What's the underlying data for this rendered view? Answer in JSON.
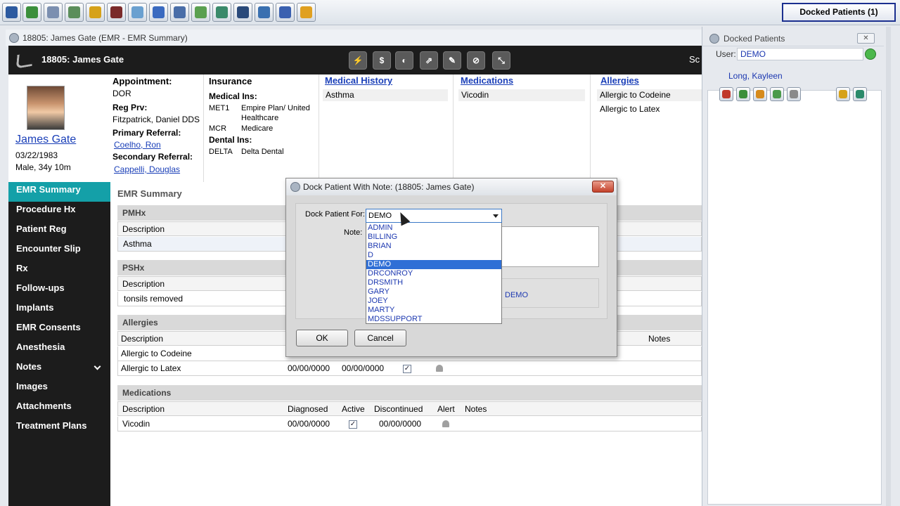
{
  "toolbar": {
    "icons": [
      "patient-icon",
      "new-icon",
      "search-icon",
      "scheduler-icon",
      "ledger-icon",
      "tooth-icon",
      "claims-icon",
      "transfer-icon",
      "reports-icon",
      "map-icon",
      "chat-icon",
      "window-icon",
      "document-icon",
      "download-icon",
      "exit-icon"
    ],
    "icon_colors": [
      "#2c5aa0",
      "#3b8f3b",
      "#7b8fb0",
      "#5b8e5b",
      "#d6a21a",
      "#7a2a2a",
      "#6aa0d0",
      "#3a6ac0",
      "#4a6ea8",
      "#5aa050",
      "#3a8a6a",
      "#2a4a7a",
      "#3a70b0",
      "#3a60b0",
      "#e0a020"
    ],
    "docked_button": "Docked Patients (1)"
  },
  "window": {
    "title": "18805: James Gate (EMR - EMR Summary)"
  },
  "header": {
    "title": "18805: James Gate",
    "right_text": "Sc",
    "buttons": [
      "⚡",
      "$",
      "◐",
      "⇗",
      "✎",
      "⊘",
      "⤡"
    ]
  },
  "patient": {
    "name": "James Gate",
    "dob": "03/22/1983",
    "sex_age": "Male, 34y 10m",
    "appointment_label": "Appointment:",
    "appointment_value": "DOR",
    "reg_prv_label": "Reg Prv:",
    "reg_prv_value": "Fitzpatrick, Daniel DDS",
    "primary_ref_label": "Primary Referral:",
    "primary_ref_value": "Coelho, Ron",
    "secondary_ref_label": "Secondary Referral:",
    "secondary_ref_value": "Cappelli, Douglas"
  },
  "insurance": {
    "title": "Insurance",
    "medical_label": "Medical Ins:",
    "medical": [
      {
        "code": "MET1",
        "name1": "Empire Plan/ United",
        "name2": "Healthcare"
      },
      {
        "code": "MCR",
        "name1": "Medicare"
      }
    ],
    "dental_label": "Dental Ins:",
    "dental": [
      {
        "code": "DELTA",
        "name1": "Delta Dental"
      }
    ]
  },
  "summary_cols": {
    "medical_history": {
      "title": "Medical History",
      "items": [
        "Asthma"
      ]
    },
    "medications": {
      "title": "Medications",
      "items": [
        "Vicodin"
      ]
    },
    "allergies": {
      "title": "Allergies",
      "items": [
        "Allergic to Codeine",
        "Allergic to Latex"
      ]
    }
  },
  "nav": [
    "EMR Summary",
    "Procedure Hx",
    "Patient Reg",
    "Encounter Slip",
    "Rx",
    "Follow-ups",
    "Implants",
    "EMR Consents",
    "Anesthesia",
    "Notes",
    "Images",
    "Attachments",
    "Treatment Plans"
  ],
  "main": {
    "title": "EMR Summary",
    "pmhx": {
      "title": "PMHx",
      "header": "Description",
      "row": "Asthma"
    },
    "pshx": {
      "title": "PSHx",
      "header": "Description",
      "row": "tonsils removed"
    },
    "allergies": {
      "title": "Allergies",
      "header": "Description",
      "notes_header": "Notes",
      "rows": [
        {
          "desc": "Allergic to Codeine"
        },
        {
          "desc": "Allergic to Latex",
          "d1": "00/00/0000",
          "d2": "00/00/0000"
        }
      ]
    },
    "medications": {
      "title": "Medications",
      "headers": [
        "Description",
        "Diagnosed",
        "Active",
        "Discontinued",
        "Alert",
        "Notes"
      ],
      "rows": [
        {
          "desc": "Vicodin",
          "diagnosed": "00/00/0000",
          "discontinued": "00/00/0000"
        }
      ]
    }
  },
  "dock_panel": {
    "title": "Docked Patients",
    "user_label": "User:",
    "user_value": "DEMO",
    "patient": "Long, Kayleen"
  },
  "modal": {
    "title": "Dock Patient With Note: (18805: James Gate)",
    "dock_for_label": "Dock Patient For:",
    "selected": "DEMO",
    "note_label": "Note:",
    "hidden_value": "DEMO",
    "options": [
      "ADMIN",
      "BILLING",
      "BRIAN",
      "D",
      "DEMO",
      "DRCONROY",
      "DRSMITH",
      "GARY",
      "JOEY",
      "MARTY",
      "MDSSUPPORT"
    ],
    "ok_label": "OK",
    "cancel_label": "Cancel"
  }
}
